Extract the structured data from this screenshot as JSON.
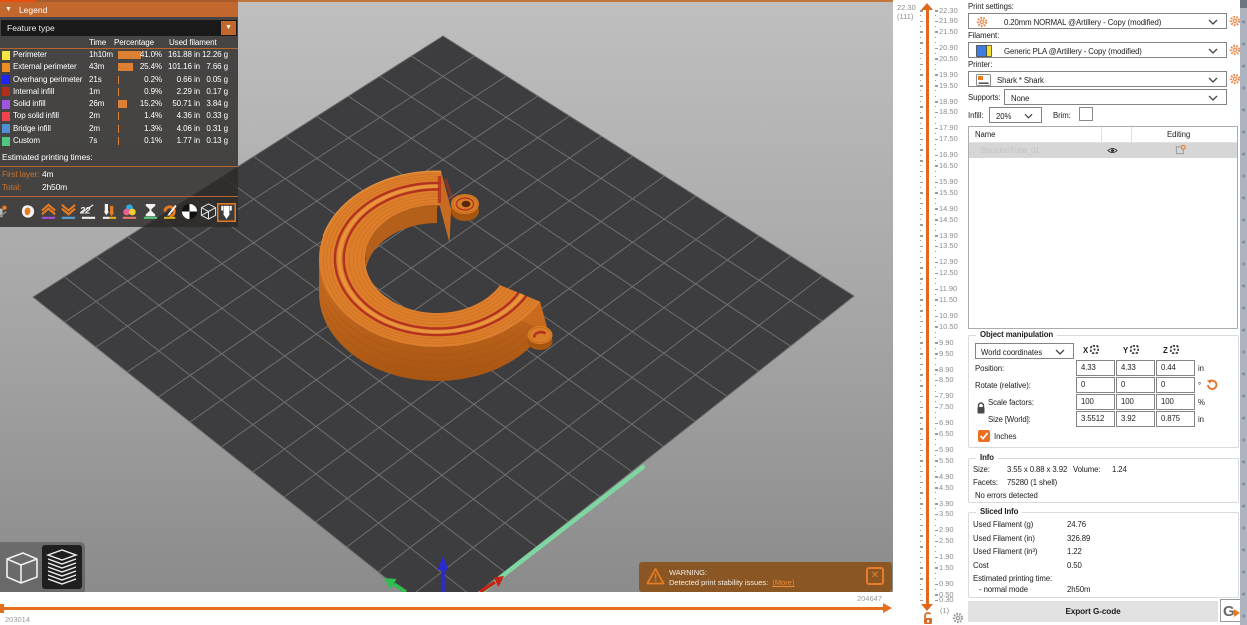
{
  "colors": {
    "accent_orange": "#e8742c",
    "legend_header": "#c2672e",
    "warning_background": "#8a5724",
    "bed": "#3d3d3f",
    "axis_x": "#c42415",
    "axis_y": "#2fbf4f",
    "axis_z": "#2a2ad2"
  },
  "legend": {
    "title": "Legend",
    "view_mode": "Feature type",
    "columns": [
      "Time",
      "Percentage",
      "Used filament"
    ],
    "rows": [
      {
        "color": "#f6e445",
        "label": "Perimeter",
        "time": "1h10m",
        "percentage": "41.0%",
        "used_in": "161.88 in",
        "used_g": "12.26 g"
      },
      {
        "color": "#f08c28",
        "label": "External perimeter",
        "time": "43m",
        "percentage": "25.4%",
        "used_in": "101.16 in",
        "used_g": "7.66 g"
      },
      {
        "color": "#2222ee",
        "label": "Overhang perimeter",
        "time": "21s",
        "percentage": "0.2%",
        "used_in": "0.66 in",
        "used_g": "0.05 g"
      },
      {
        "color": "#af2f1d",
        "label": "Internal infill",
        "time": "1m",
        "percentage": "0.9%",
        "used_in": "2.29 in",
        "used_g": "0.17 g"
      },
      {
        "color": "#9e55e0",
        "label": "Solid infill",
        "time": "26m",
        "percentage": "15.2%",
        "used_in": "50.71 in",
        "used_g": "3.84 g"
      },
      {
        "color": "#f0444c",
        "label": "Top solid infill",
        "time": "2m",
        "percentage": "1.4%",
        "used_in": "4.36 in",
        "used_g": "0.33 g"
      },
      {
        "color": "#4d8fd2",
        "label": "Bridge infill",
        "time": "2m",
        "percentage": "1.3%",
        "used_in": "4.06 in",
        "used_g": "0.31 g"
      },
      {
        "color": "#4fc77f",
        "label": "Custom",
        "time": "7s",
        "percentage": "0.1%",
        "used_in": "1.77 in",
        "used_g": "0.13 g"
      }
    ],
    "times_title": "Estimated printing times:",
    "first_layer_label": "First layer:",
    "first_layer_value": "4m",
    "total_label": "Total:",
    "total_value": "2h50m"
  },
  "toolbar": {
    "icons": [
      "shells-partial",
      "object-visibility",
      "retractions",
      "deretractions",
      "seams",
      "tool-changes",
      "color-changes",
      "pause-prints",
      "custom-gcodes",
      "center-of-gravity",
      "shells",
      "tool-position"
    ]
  },
  "warning": {
    "title": "WARNING:",
    "message": "Detected print stability issues:",
    "link_label": "(More)"
  },
  "gcode_slider": {
    "max_label": "204647",
    "min_label": "203014"
  },
  "layer_slider": {
    "current_value": "22.30",
    "current_layers": "(111)",
    "bottom_layer": "(1)",
    "step": 0.2,
    "labels": [
      "22.30",
      "21.90",
      "21.50",
      "20.90",
      "20.50",
      "19.90",
      "19.50",
      "18.90",
      "18.50",
      "17.90",
      "17.50",
      "16.90",
      "16.50",
      "15.90",
      "15.50",
      "14.90",
      "14.50",
      "13.90",
      "13.50",
      "12.90",
      "12.50",
      "11.90",
      "11.50",
      "10.90",
      "10.50",
      "9.90",
      "9.50",
      "8.90",
      "8.50",
      "7.90",
      "7.50",
      "6.90",
      "6.50",
      "5.90",
      "5.50",
      "4.90",
      "4.50",
      "3.90",
      "3.50",
      "2.90",
      "2.50",
      "1.90",
      "1.50",
      "0.90",
      "0.50",
      "0.30"
    ]
  },
  "settings": {
    "print": {
      "label": "Print settings:",
      "value": "0.20mm NORMAL @Artillery - Copy (modified)"
    },
    "filament": {
      "label": "Filament:",
      "value": "Generic PLA @Artillery - Copy (modified)"
    },
    "printer": {
      "label": "Printer:",
      "value": "Shark * Shark"
    },
    "supports": {
      "label": "Supports:",
      "value": "None"
    },
    "infill": {
      "label": "Infill:",
      "value": "20%"
    },
    "brim": {
      "label": "Brim:",
      "checked": false
    }
  },
  "object_list": {
    "columns": [
      "Name",
      "Editing"
    ],
    "rows": [
      {
        "name": "BourdonTube_01"
      }
    ]
  },
  "manipulation": {
    "title": "Object manipulation",
    "coordinates": "World coordinates",
    "axes": [
      "X",
      "Y",
      "Z"
    ],
    "rows": [
      {
        "label": "Position:",
        "values": [
          "4.33",
          "4.33",
          "0.44"
        ],
        "unit": "in",
        "indent": false
      },
      {
        "label": "Rotate (relative):",
        "values": [
          "0",
          "0",
          "0"
        ],
        "unit": "°",
        "indent": false
      },
      {
        "label": "Scale factors:",
        "values": [
          "100",
          "100",
          "100"
        ],
        "unit": "%",
        "indent": true
      },
      {
        "label": "Size [World]:",
        "values": [
          "3.5512",
          "3.92",
          "0.875"
        ],
        "unit": "in",
        "indent": true
      }
    ],
    "inches_label": "Inches",
    "inches_checked": true
  },
  "info": {
    "title": "Info",
    "size_label": "Size:",
    "size_value": "3.55 x 0.88 x 3.92",
    "volume_label": "Volume:",
    "volume_value": "1.24",
    "facets_label": "Facets:",
    "facets_value": "75280 (1 shell)",
    "errors_value": "No errors detected"
  },
  "sliced": {
    "title": "Sliced Info",
    "rows": [
      {
        "label": "Used Filament (g)",
        "value": "24.76"
      },
      {
        "label": "Used Filament (in)",
        "value": "326.89"
      },
      {
        "label": "Used Filament (in³)",
        "value": "1.22"
      },
      {
        "label": "Cost",
        "value": "0.50"
      }
    ],
    "time_label": "Estimated printing time:",
    "mode_label": "- normal mode",
    "mode_value": "2h50m"
  },
  "export_label": "Export G-code"
}
